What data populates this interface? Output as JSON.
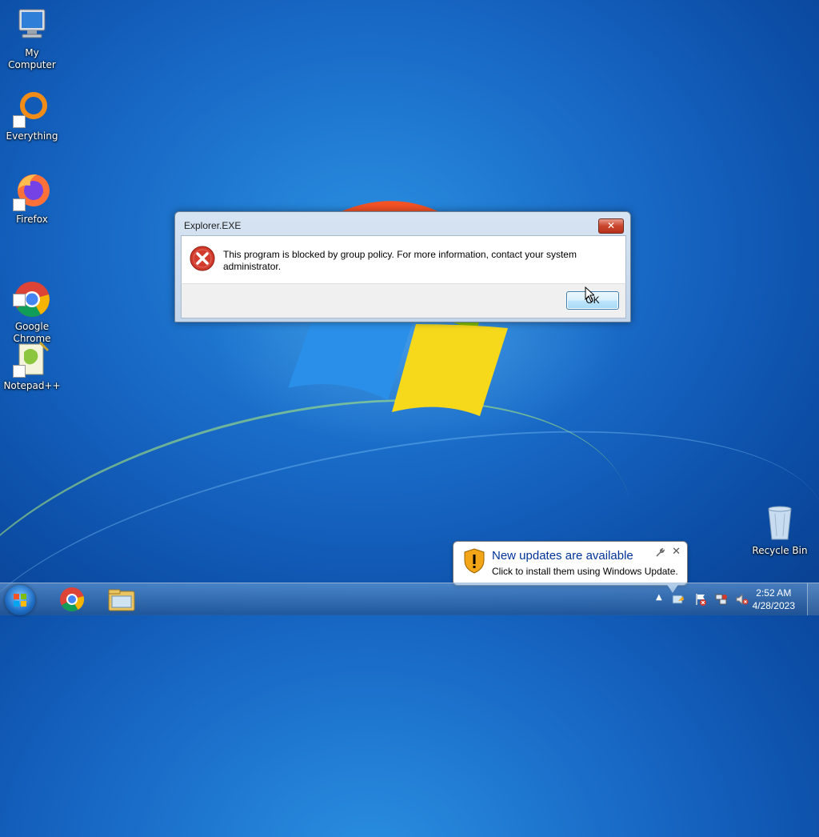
{
  "desktop": {
    "icons": [
      {
        "label": "My Computer",
        "icon": "computer-icon"
      },
      {
        "label": "Everything",
        "icon": "everything-icon"
      },
      {
        "label": "Firefox",
        "icon": "firefox-icon"
      },
      {
        "label": "Google\nChrome",
        "icon": "chrome-icon"
      },
      {
        "label": "Notepad++",
        "icon": "notepadpp-icon"
      },
      {
        "label": "Recycle Bin",
        "icon": "recycle-bin-icon"
      }
    ]
  },
  "dialog": {
    "title": "Explorer.EXE",
    "close_label": "✕",
    "message": "This program is blocked by group policy. For more information, contact your system administrator.",
    "ok_label": "OK",
    "icon": "error-icon"
  },
  "notification": {
    "title": "New updates are available",
    "text": "Click to install them using Windows Update.",
    "close_label": "✕",
    "icon": "shield-warning-icon"
  },
  "taskbar": {
    "pinned": [
      {
        "name": "chrome",
        "icon": "chrome-icon"
      },
      {
        "name": "explorer",
        "icon": "folder-icon"
      }
    ],
    "clock": {
      "time": "2:52 AM",
      "date": "4/28/2023"
    },
    "tray_arrow": "▲"
  },
  "colors": {
    "desktop_blue": "#1767c4",
    "balloon_title": "#003399",
    "close_red": "#c9442c"
  }
}
